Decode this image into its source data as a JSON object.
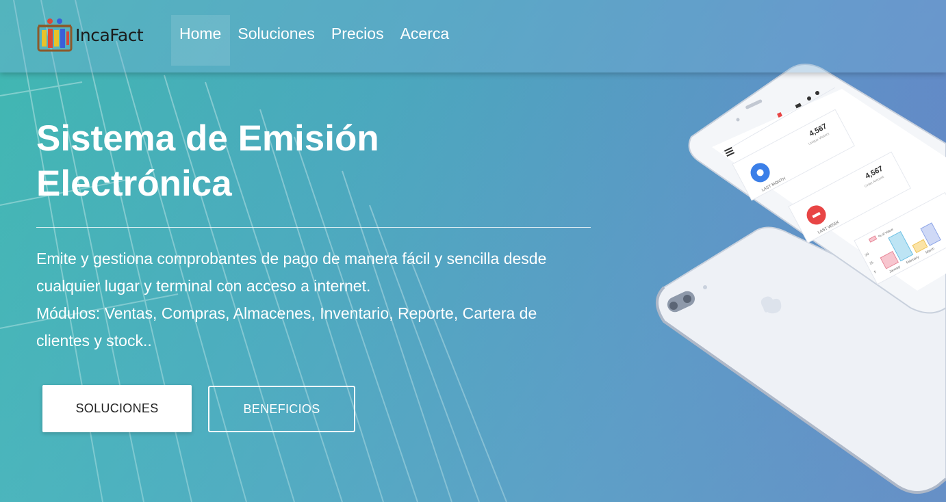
{
  "brand": {
    "name": "IncaFact",
    "logo_icon": "abacus-logo-icon"
  },
  "nav": {
    "items": [
      {
        "label": "Home",
        "active": true
      },
      {
        "label": "Soluciones"
      },
      {
        "label": "Precios"
      },
      {
        "label": "Acerca"
      }
    ]
  },
  "hero": {
    "title_line1": "Sistema de Emisión",
    "title_line2": "Electrónica",
    "description_1": "Emite y gestiona comprobantes de pago de manera fácil y sencilla desde cualquier lugar y terminal con acceso a internet.",
    "description_2": "Módulos: Ventas, Compras, Almacenes, Inventario, Reporte, Cartera de clientes y stock..",
    "primary_button": "SOLUCIONES",
    "secondary_button": "BENEFICIOS"
  },
  "phone_screen": {
    "card1": {
      "value": "4,567",
      "sub": "Unique Visitors",
      "label": "LAST MONTH"
    },
    "card2": {
      "value": "4,567",
      "sub": "Order Amount",
      "label": "LAST WEEK"
    },
    "chart_legend": "% of Value",
    "chart_ticks": [
      "20",
      "15",
      "5"
    ],
    "chart_months": [
      "January",
      "February",
      "March"
    ]
  },
  "colors": {
    "gradient_start": "#3fb7b0",
    "gradient_end": "#6a79c6",
    "button_solid_bg": "#ffffff",
    "icon_blue": "#3b7fe8",
    "icon_red": "#e84545"
  }
}
